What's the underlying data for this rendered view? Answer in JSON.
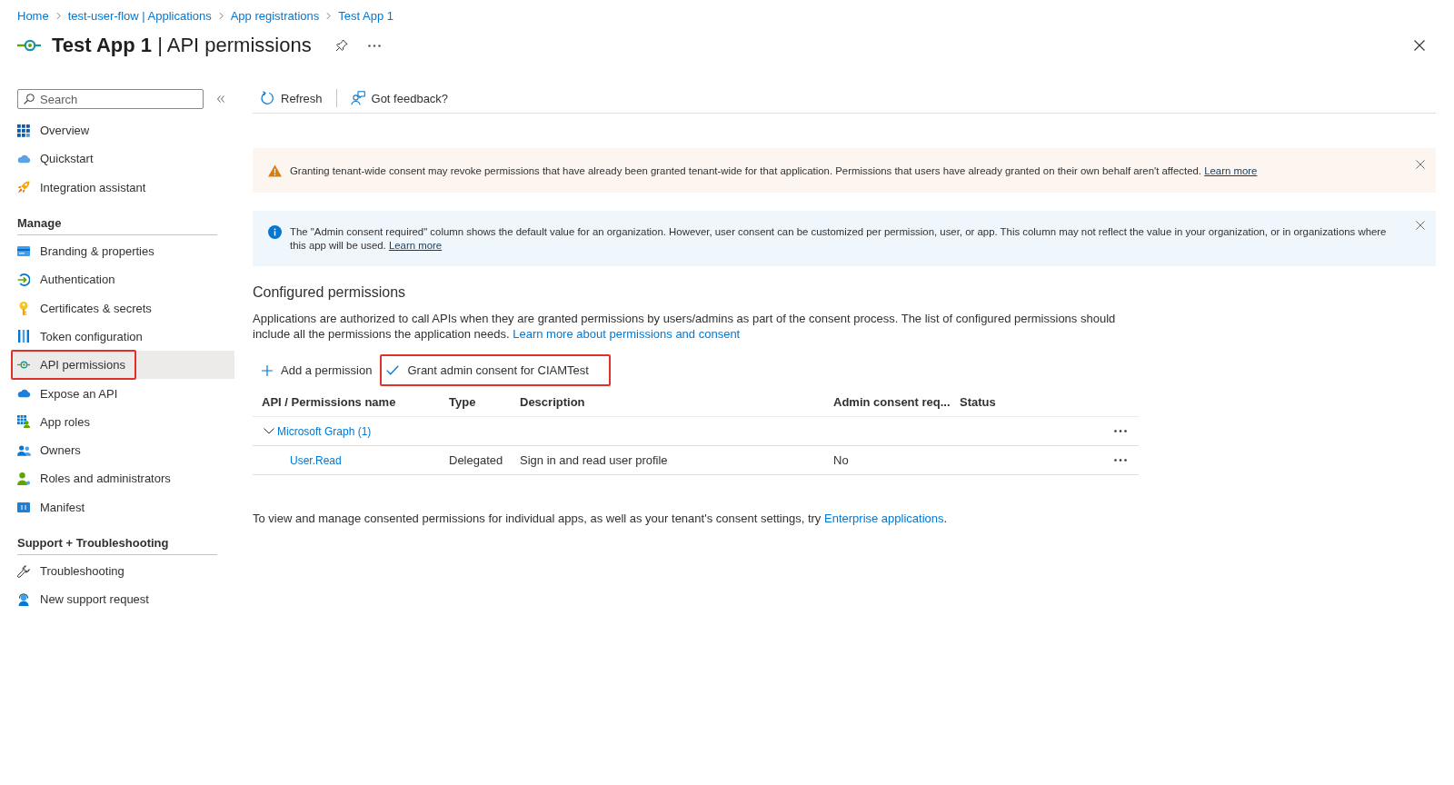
{
  "breadcrumb": [
    "Home",
    "test-user-flow | Applications",
    "App registrations",
    "Test App 1"
  ],
  "page_title": "**Test App 1** | API permissions",
  "sidebar": {
    "search": {
      "placeholder": "Search"
    },
    "sections": [
      {
        "items": [
          {
            "label": "Overview",
            "selected": false,
            "highlighted": false
          },
          {
            "label": "Quickstart",
            "selected": false,
            "highlighted": false
          },
          {
            "label": "Integration assistant",
            "selected": false,
            "highlighted": false
          }
        ]
      },
      {
        "heading": "Manage",
        "items": [
          {
            "label": "Branding & properties",
            "selected": false,
            "highlighted": false
          },
          {
            "label": "Authentication",
            "selected": false,
            "highlighted": false
          },
          {
            "label": "Certificates & secrets",
            "selected": false,
            "highlighted": false
          },
          {
            "label": "Token configuration",
            "selected": false,
            "highlighted": false
          },
          {
            "label": "API permissions",
            "selected": true,
            "highlighted": true
          },
          {
            "label": "Expose an API",
            "selected": false,
            "highlighted": false
          },
          {
            "label": "App roles",
            "selected": false,
            "highlighted": false
          },
          {
            "label": "Owners",
            "selected": false,
            "highlighted": false
          },
          {
            "label": "Roles and administrators",
            "selected": false,
            "highlighted": false
          },
          {
            "label": "Manifest",
            "selected": false,
            "highlighted": false
          }
        ]
      },
      {
        "heading": "Support + Troubleshooting",
        "items": [
          {
            "label": "Troubleshooting",
            "selected": false,
            "highlighted": false
          },
          {
            "label": "New support request",
            "selected": false,
            "highlighted": false
          }
        ]
      }
    ]
  },
  "toolbar": [
    "Refresh",
    "Got feedback?"
  ],
  "banners": [
    {
      "kind": "warning",
      "text": "Granting tenant-wide consent may revoke permissions that have already been granted tenant-wide for that application. Permissions that users have already granted on their own behalf aren't affected.",
      "link": "Learn more"
    },
    {
      "kind": "info",
      "text": "The \"Admin consent required\" column shows the default value for an organization. However, user consent can be customized per permission, user, or app. This column may not reflect the value in your organization, or in organizations where this app will be used.",
      "link": "Learn more"
    }
  ],
  "configured_permissions": {
    "title": "Configured permissions",
    "description": "Applications are authorized to call APIs when they are granted permissions by users/admins as part of the consent process. The list of configured permissions should include all the permissions the application needs.",
    "description_link": "Learn more about permissions and consent",
    "commands": [
      {
        "kind": "add",
        "label": "Add a permission",
        "highlighted": false
      },
      {
        "kind": "grant",
        "label": "Grant admin consent for CIAMTest",
        "highlighted": true
      }
    ],
    "table": {
      "columns": [
        "API / Permissions name",
        "Type",
        "Description",
        "Admin consent req...",
        "Status"
      ],
      "groups": [
        {
          "name": "Microsoft Graph (1)",
          "expanded": true,
          "rows": [
            {
              "name": "User.Read",
              "type": "Delegated",
              "description": "Sign in and read user profile",
              "admin_consent": "No"
            }
          ]
        }
      ]
    }
  },
  "footer": {
    "text": "To view and manage consented permissions for individual apps, as well as your tenant's consent settings, try",
    "link": "Enterprise applications",
    "text_after": "."
  }
}
